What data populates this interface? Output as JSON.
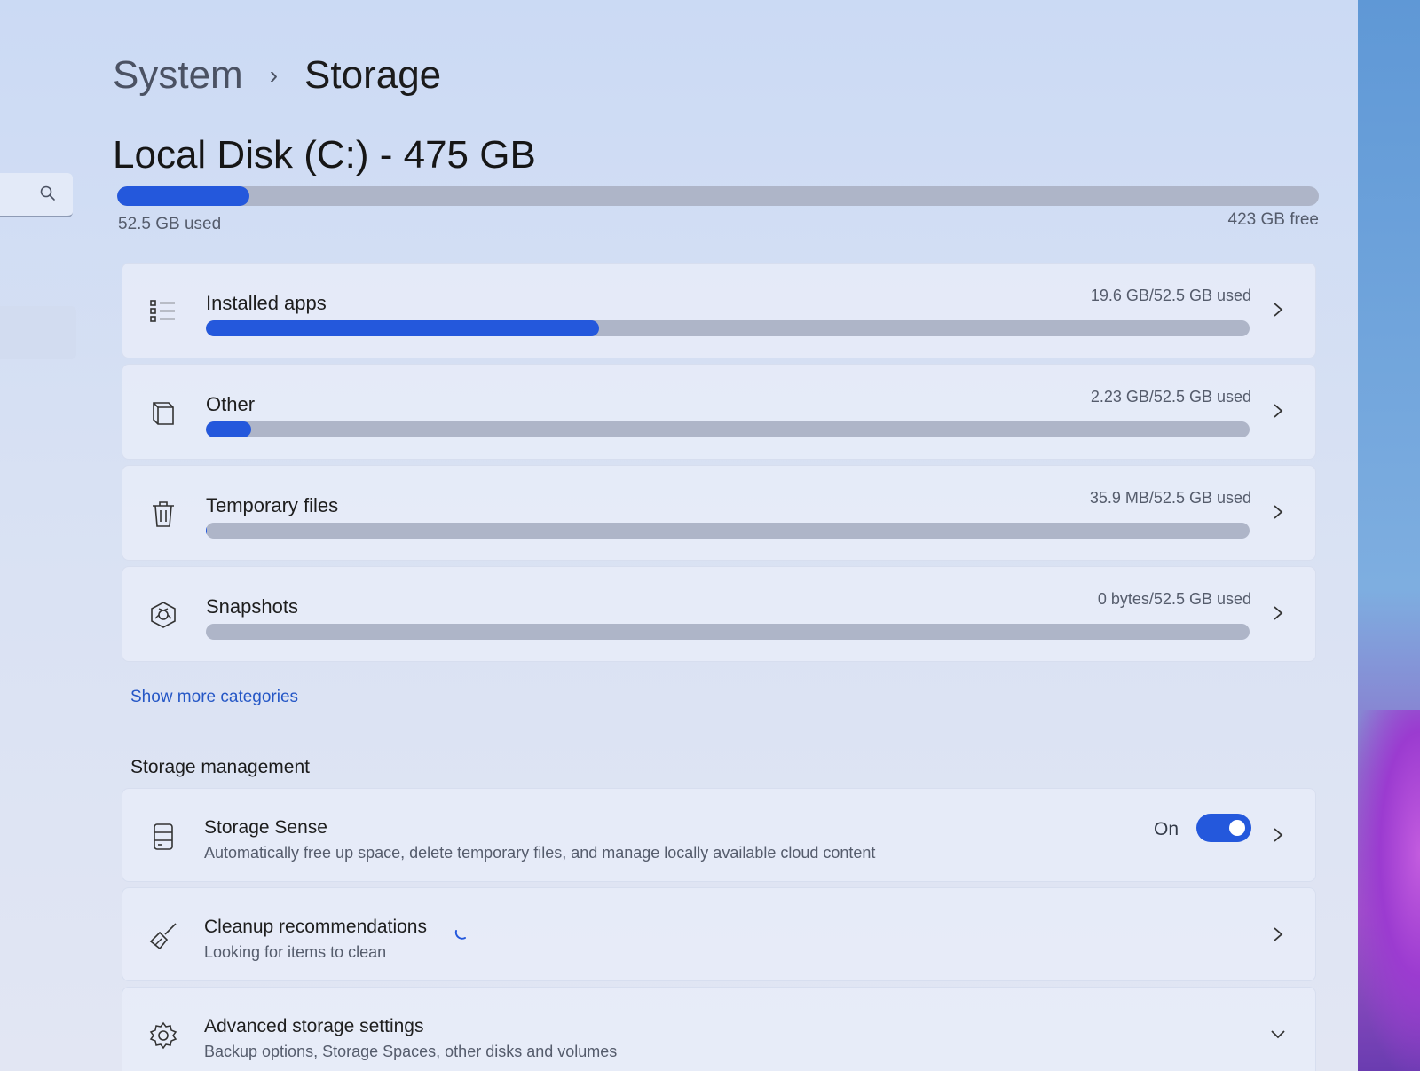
{
  "breadcrumb": {
    "parent": "System",
    "separator": "›",
    "current": "Storage"
  },
  "disk": {
    "title": "Local Disk (C:) - 475 GB",
    "used_label": "52.5 GB used",
    "free_label": "423 GB free",
    "used_fraction": 0.11
  },
  "categories": [
    {
      "label": "Installed apps",
      "amount": "19.6 GB/52.5 GB used",
      "fraction": 0.377,
      "icon": "list-icon"
    },
    {
      "label": "Other",
      "amount": "2.23 GB/52.5 GB used",
      "fraction": 0.043,
      "icon": "document-icon"
    },
    {
      "label": "Temporary files",
      "amount": "35.9 MB/52.5 GB used",
      "fraction": 0.001,
      "icon": "trash-icon"
    },
    {
      "label": "Snapshots",
      "amount": "0 bytes/52.5 GB used",
      "fraction": 0.0,
      "icon": "snapshot-icon"
    }
  ],
  "show_more": "Show more categories",
  "management": {
    "title": "Storage management",
    "items": [
      {
        "title": "Storage Sense",
        "desc": "Automatically free up space, delete temporary files, and manage locally available cloud content",
        "toggle_label": "On",
        "icon": "storage-drive-icon"
      },
      {
        "title": "Cleanup recommendations",
        "desc": "Looking for items to clean",
        "icon": "broom-icon"
      },
      {
        "title": "Advanced storage settings",
        "desc": "Backup options, Storage Spaces, other disks and volumes",
        "icon": "gear-icon"
      }
    ]
  },
  "colors": {
    "accent": "#2458dc",
    "bar_track": "#aeb5c8",
    "link": "#2557c6"
  }
}
